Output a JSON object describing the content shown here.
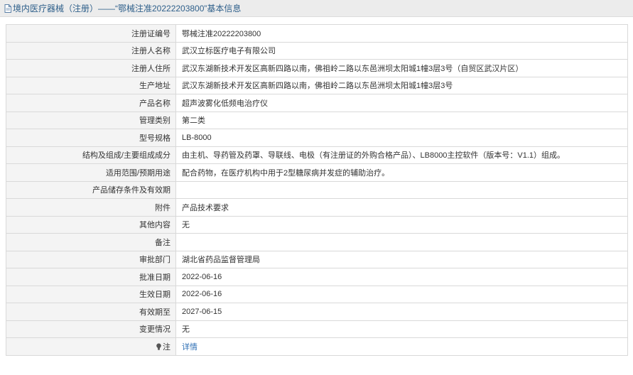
{
  "header": {
    "icon": "document-icon",
    "title": "境内医疗器械（注册）——“鄂械注准20222203800”基本信息"
  },
  "rows": [
    {
      "label": "注册证编号",
      "value": "鄂械注准20222203800"
    },
    {
      "label": "注册人名称",
      "value": "武汉立标医疗电子有限公司"
    },
    {
      "label": "注册人住所",
      "value": "武汉东湖新技术开发区高新四路以南，佛祖岭二路以东邑洲坝太阳城1幢3层3号（自贸区武汉片区）"
    },
    {
      "label": "生产地址",
      "value": "武汉东湖新技术开发区高新四路以南，佛祖岭二路以东邑洲坝太阳城1幢3层3号"
    },
    {
      "label": "产品名称",
      "value": "超声波雾化低频电治疗仪"
    },
    {
      "label": "管理类别",
      "value": "第二类"
    },
    {
      "label": "型号规格",
      "value": "LB-8000"
    },
    {
      "label": "结构及组成/主要组成成分",
      "value": "由主机、导药管及药罩、导联线、电极（有注册证的外购合格产品）、LB8000主控软件（版本号：V1.1）组成。"
    },
    {
      "label": "适用范围/预期用途",
      "value": "配合药物，在医疗机构中用于2型糖尿病并发症的辅助治疗。"
    },
    {
      "label": "产品储存条件及有效期",
      "value": ""
    },
    {
      "label": "附件",
      "value": "产品技术要求"
    },
    {
      "label": "其他内容",
      "value": "无"
    },
    {
      "label": "备注",
      "value": ""
    },
    {
      "label": "审批部门",
      "value": "湖北省药品监督管理局"
    },
    {
      "label": "批准日期",
      "value": "2022-06-16"
    },
    {
      "label": "生效日期",
      "value": "2022-06-16"
    },
    {
      "label": "有效期至",
      "value": "2027-06-15"
    },
    {
      "label": "变更情况",
      "value": "无"
    }
  ],
  "note_row": {
    "icon": "lightbulb-icon",
    "label": "注",
    "link_text": "详情"
  },
  "colors": {
    "title_text": "#2e5f8a",
    "link": "#2e6fb5",
    "label_bg": "#f4f4f4",
    "border": "#d9d9d9"
  }
}
